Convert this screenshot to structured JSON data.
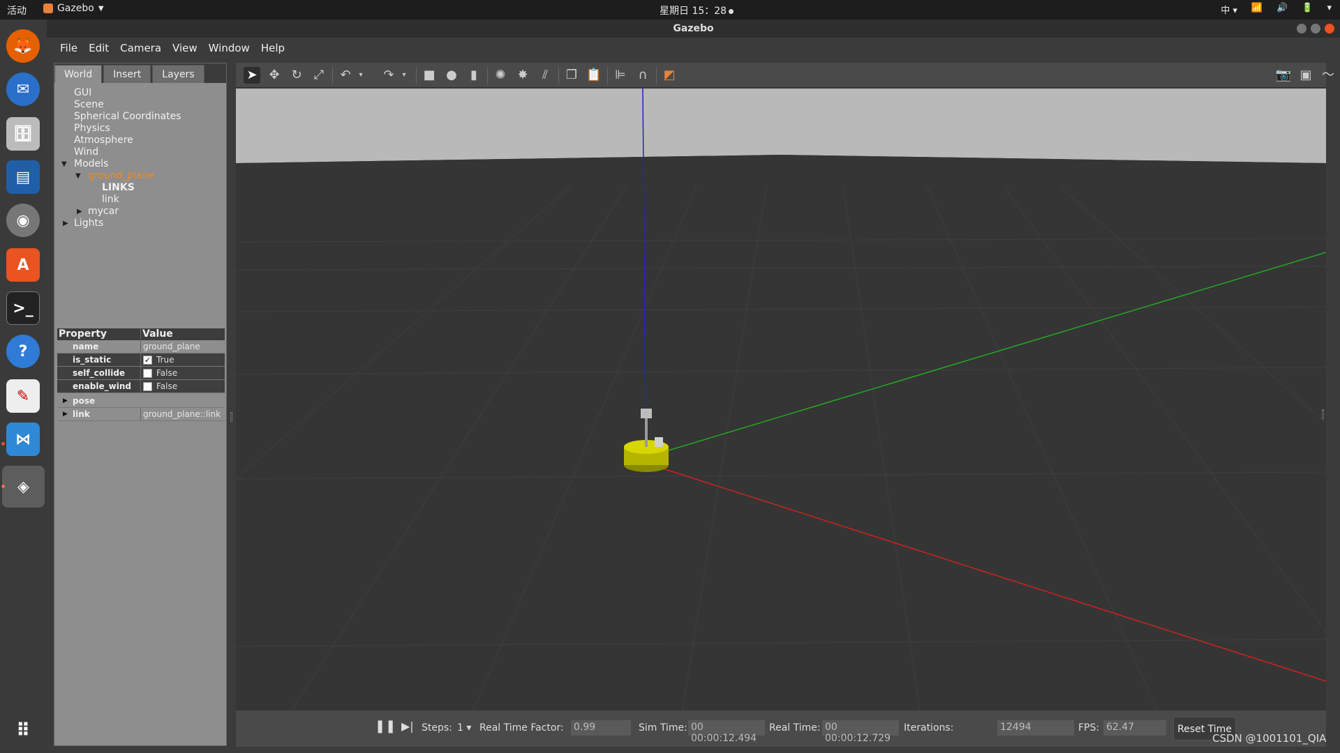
{
  "topbar": {
    "activities": "活动",
    "app_name": "Gazebo",
    "clock": "星期日 15：28",
    "input_method": "中"
  },
  "window": {
    "title": "Gazebo"
  },
  "menu": [
    "File",
    "Edit",
    "Camera",
    "View",
    "Window",
    "Help"
  ],
  "tabs": [
    "World",
    "Insert",
    "Layers"
  ],
  "tree": {
    "gui": "GUI",
    "scene": "Scene",
    "spherical": "Spherical Coordinates",
    "physics": "Physics",
    "atmosphere": "Atmosphere",
    "wind": "Wind",
    "models": "Models",
    "ground_plane": "ground_plane",
    "links": "LINKS",
    "link": "link",
    "mycar": "mycar",
    "lights": "Lights"
  },
  "properties": {
    "header_property": "Property",
    "header_value": "Value",
    "rows": [
      {
        "name": "name",
        "value": "ground_plane"
      },
      {
        "name": "is_static",
        "value": "True",
        "checked": true
      },
      {
        "name": "self_collide",
        "value": "False",
        "checked": false
      },
      {
        "name": "enable_wind",
        "value": "False",
        "checked": false
      },
      {
        "name": "pose",
        "value": ""
      },
      {
        "name": "link",
        "value": "ground_plane::link"
      }
    ]
  },
  "bottombar": {
    "steps_label": "Steps:",
    "steps_value": "1",
    "rtf_label": "Real Time Factor:",
    "rtf_value": "0.99",
    "sim_label": "Sim Time:",
    "sim_value": "00 00:00:12.494",
    "real_label": "Real Time:",
    "real_value": "00 00:00:12.729",
    "iter_label": "Iterations:",
    "iter_value": "12494",
    "fps_label": "FPS:",
    "fps_value": "62.47",
    "reset_label": "Reset Time"
  },
  "watermark": "CSDN @1001101_QIA",
  "colors": {
    "selected_tree": "#f08a24",
    "x_axis": "#cc2222",
    "y_axis": "#22aa22",
    "z_axis": "#2222cc",
    "robot_base": "#b5b500",
    "ubuntu_accent": "#e95420"
  }
}
